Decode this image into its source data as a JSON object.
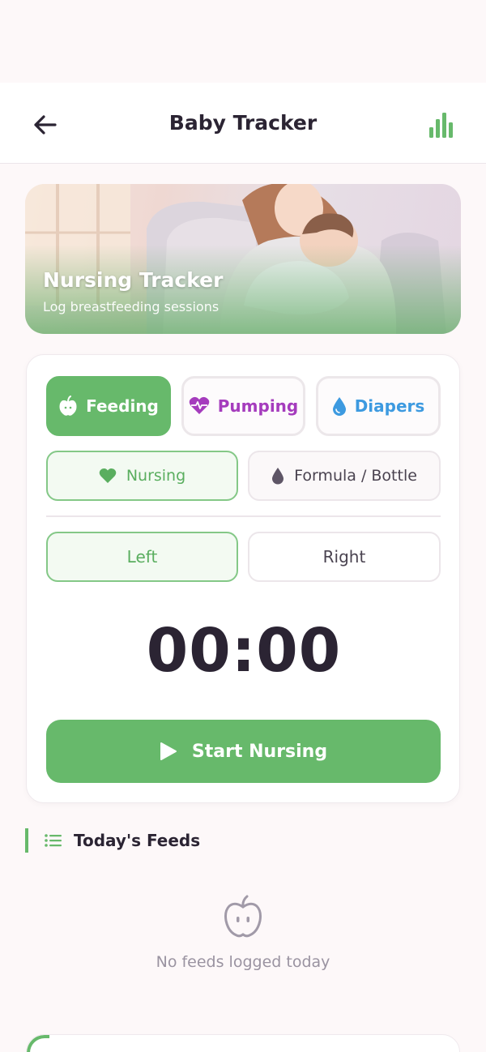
{
  "header": {
    "title": "Baby Tracker",
    "back_icon": "arrow-left-icon",
    "stats_icon": "bar-chart-icon"
  },
  "hero": {
    "title": "Nursing Tracker",
    "subtitle": "Log breastfeeding sessions"
  },
  "categories": [
    {
      "label": "Feeding",
      "icon": "apple-icon",
      "active": true
    },
    {
      "label": "Pumping",
      "icon": "heart-pulse-icon",
      "active": false
    },
    {
      "label": "Diapers",
      "icon": "droplet-icon",
      "active": false
    }
  ],
  "feed_types": [
    {
      "label": "Nursing",
      "icon": "heart-icon",
      "active": true
    },
    {
      "label": "Formula / Bottle",
      "icon": "droplet-icon",
      "active": false
    }
  ],
  "sides": [
    {
      "label": "Left",
      "active": true
    },
    {
      "label": "Right",
      "active": false
    }
  ],
  "timer": {
    "value": "00:00"
  },
  "start_button": {
    "label": "Start Nursing",
    "icon": "play-icon"
  },
  "todays_feeds": {
    "title": "Today's Feeds",
    "icon": "list-icon",
    "empty_text": "No feeds logged today",
    "empty_icon": "apple-face-icon"
  },
  "colors": {
    "accent": "#67b96b",
    "pumping": "#a53cbd",
    "diapers": "#3d9ae0",
    "text": "#2b2433",
    "muted": "#9a93a1",
    "background": "#fdf8f9"
  }
}
